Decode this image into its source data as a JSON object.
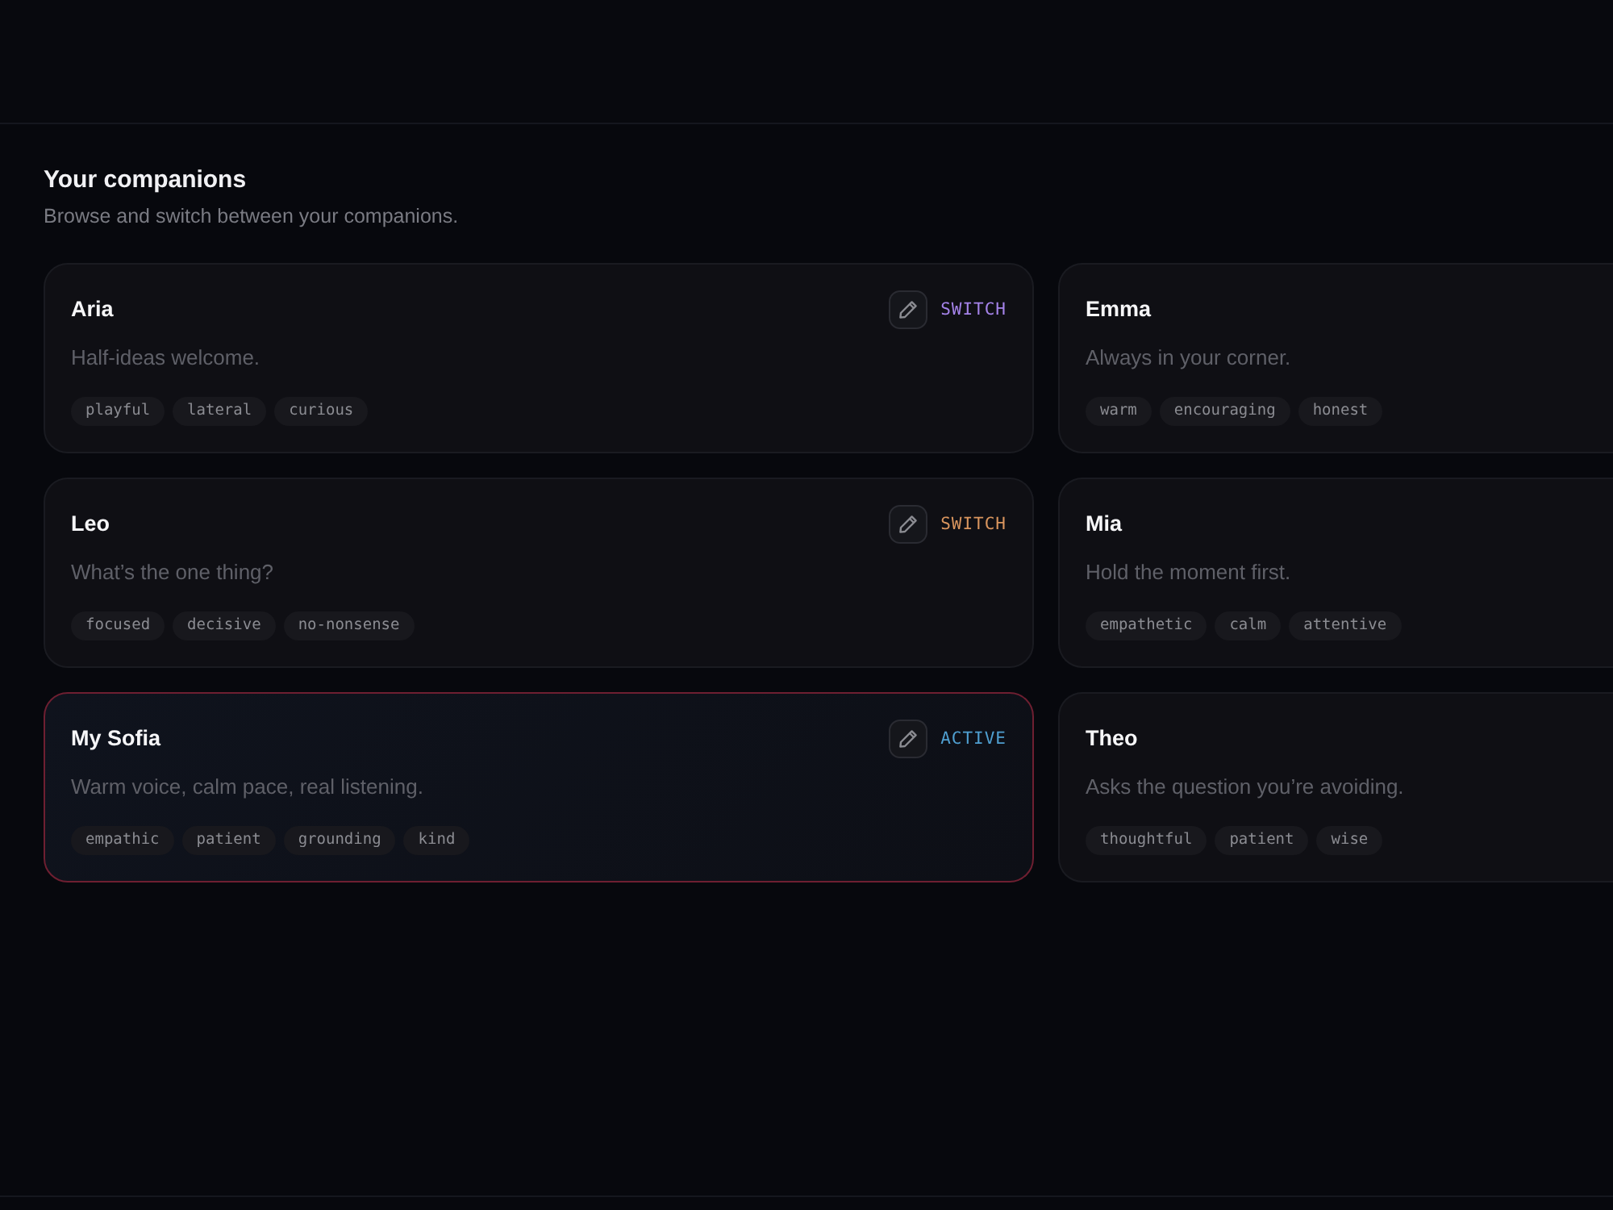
{
  "header": {
    "title": "Your companions",
    "subtitle": "Browse and switch between your companions."
  },
  "companions": [
    {
      "name": "Aria",
      "tagline": "Half-ideas welcome.",
      "tags": [
        "playful",
        "lateral",
        "curious"
      ],
      "selected": false,
      "action": {
        "label": "SWITCH",
        "color": "#a583ea"
      }
    },
    {
      "name": "Emma",
      "tagline": "Always in your corner.",
      "tags": [
        "warm",
        "encouraging",
        "honest"
      ],
      "selected": false
    },
    {
      "name": "Leo",
      "tagline": "What’s the one thing?",
      "tags": [
        "focused",
        "decisive",
        "no-nonsense"
      ],
      "selected": false,
      "action": {
        "label": "SWITCH",
        "color": "#d9955e"
      }
    },
    {
      "name": "Mia",
      "tagline": "Hold the moment first.",
      "tags": [
        "empathetic",
        "calm",
        "attentive"
      ],
      "selected": false
    },
    {
      "name": "My Sofia",
      "tagline": "Warm voice, calm pace, real listening.",
      "tags": [
        "empathic",
        "patient",
        "grounding",
        "kind"
      ],
      "selected": true,
      "action": {
        "label": "ACTIVE",
        "color": "#4f9fd0"
      }
    },
    {
      "name": "Theo",
      "tagline": "Asks the question you’re avoiding.",
      "tags": [
        "thoughtful",
        "patient",
        "wise"
      ],
      "selected": false
    }
  ]
}
